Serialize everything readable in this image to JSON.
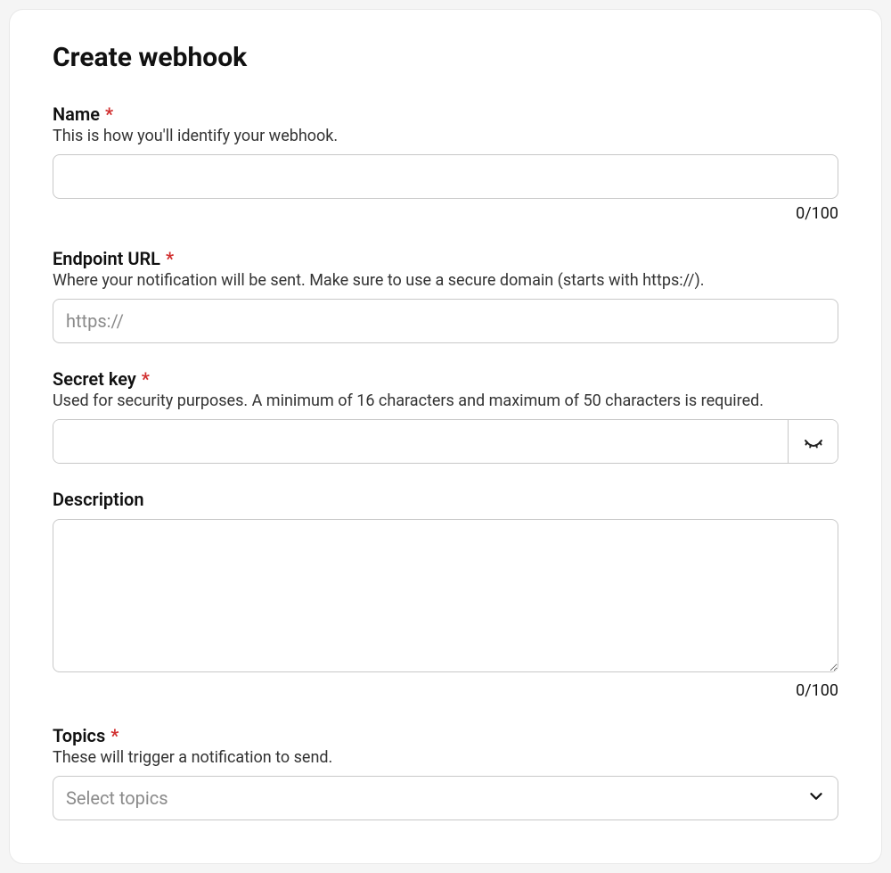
{
  "title": "Create webhook",
  "required_mark": "*",
  "fields": {
    "name": {
      "label": "Name",
      "help": "This is how you'll identify your webhook.",
      "value": "",
      "counter": "0/100"
    },
    "endpoint": {
      "label": "Endpoint URL",
      "help": "Where your notification will be sent. Make sure to use a secure domain (starts with https://).",
      "placeholder": "https://",
      "value": ""
    },
    "secret": {
      "label": "Secret key",
      "help": "Used for security purposes. A minimum of 16 characters and maximum of 50 characters is required.",
      "value": ""
    },
    "description": {
      "label": "Description",
      "value": "",
      "counter": "0/100"
    },
    "topics": {
      "label": "Topics",
      "help": "These will trigger a notification to send.",
      "placeholder": "Select topics"
    }
  }
}
